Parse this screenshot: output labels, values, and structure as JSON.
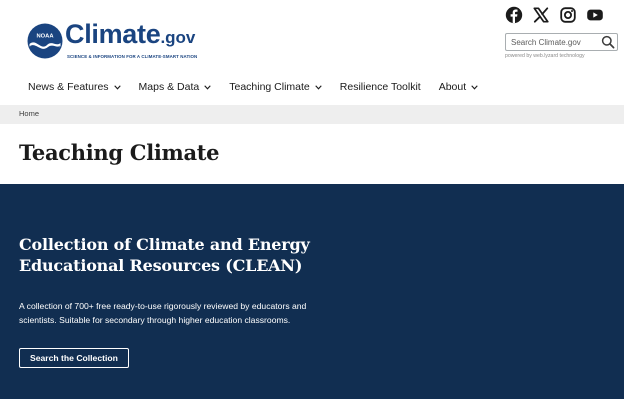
{
  "header": {
    "logo": {
      "badge_text": "NOAA",
      "name": "Climate",
      "suffix": ".gov",
      "tagline": "SCIENCE & INFORMATION FOR A CLIMATE-SMART NATION",
      "brand_color": "#1a4480"
    },
    "social": [
      {
        "icon": "facebook-icon"
      },
      {
        "icon": "x-icon"
      },
      {
        "icon": "instagram-icon"
      },
      {
        "icon": "youtube-icon"
      }
    ],
    "search": {
      "placeholder": "Search Climate.gov",
      "value": "",
      "powered_by": "powered by web.lyzard technology"
    },
    "nav": [
      {
        "label": "News & Features",
        "has_dropdown": true
      },
      {
        "label": "Maps & Data",
        "has_dropdown": true
      },
      {
        "label": "Teaching Climate",
        "has_dropdown": true
      },
      {
        "label": "Resilience Toolkit",
        "has_dropdown": false
      },
      {
        "label": "About",
        "has_dropdown": true
      }
    ]
  },
  "breadcrumb": [
    "Home"
  ],
  "page": {
    "title": "Teaching Climate"
  },
  "hero": {
    "heading": "Collection of Climate and Energy Educational Resources (CLEAN)",
    "text": "A collection of 700+ free ready-to-use rigorously reviewed by educators and scientists. Suitable for secondary through higher education classrooms.",
    "button_label": "Search the Collection",
    "background_color": "#112e51"
  }
}
